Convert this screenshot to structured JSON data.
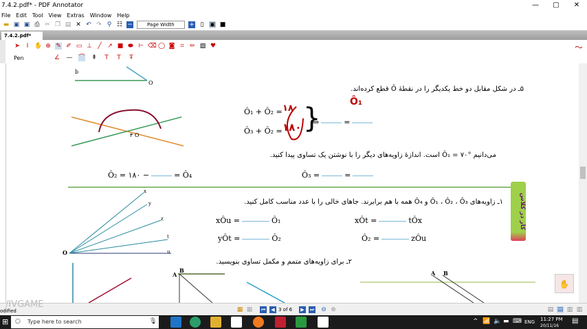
{
  "window": {
    "title": "7.4.2.pdf* - PDF Annotator",
    "minimize": "—",
    "maximize": "▢",
    "close": "✕"
  },
  "menu": [
    "File",
    "Edit",
    "Tool",
    "View",
    "Extras",
    "Window",
    "Help"
  ],
  "toolbar": {
    "zoom_mode": "Page Width"
  },
  "tab": {
    "label": "7.4.2.pdf*"
  },
  "annot_toolbar": {
    "pen_label": "Pen"
  },
  "page": {
    "q5_title": "۵ـ در شکل مقابل دو خط یکدیگر را در نقطهٔ Ô قطع کرده‌اند.",
    "eq1": "Ô₁ + Ô₂ =",
    "eq2": "Ô₃ + Ô₂ =",
    "handwritten_1": "۱۸",
    "handwritten_2": "۱۸۰",
    "handwritten_3": "Ô₁",
    "implies": "⇒",
    "eq_sign": "=",
    "known": "می‌دانیم °Ô₁ = ۷۰ است. اندازهٔ زاویه‌های دیگر را با نوشتن یک تساوی پیدا کنید.",
    "eq3_left": "Ô₂ = ۱۸۰ −",
    "eq3_right": "= Ô₄",
    "eq4": "Ô₃ =",
    "label_b": "b",
    "label_o": "O",
    "label_o2": "۴ O",
    "side_badge": "کار در کلاس",
    "q1": "۱ـ زاویه‌های Ô₁ ، Ô₂ ، Ô₃ و Ô₄ همه با هم برابرند. جاهای خالی را با عدد مناسب کامل کنید.",
    "r1a": "xÔu =",
    "r1a_end": "Ô₁",
    "r1b": "xÔt =",
    "r1b_end": "tÔx",
    "r2a": "yÔt =",
    "r2a_end": "Ô₂",
    "r2b": "Ô₂ =",
    "r2b_end": "zÔu",
    "q2": "۲ـ برای زاویه‌های متمم و مکمل تساوی بنویسید.",
    "rays": [
      "x",
      "y",
      "z",
      "t",
      "u"
    ],
    "fig_A": "A",
    "fig_B": "B"
  },
  "statusbar": {
    "left": "odified",
    "page_indicator": "3 of 6",
    "watermark": "/IVGAME"
  },
  "taskbar": {
    "search_placeholder": "Type here to search",
    "lang": "ENG",
    "time": "11:27 PM",
    "date": "20/11/16"
  },
  "colors": {
    "accent_red": "#c00000",
    "line_green": "#6aa84f",
    "blank_blue": "#7ab8d9",
    "taskbar": "#1b1b1b"
  }
}
